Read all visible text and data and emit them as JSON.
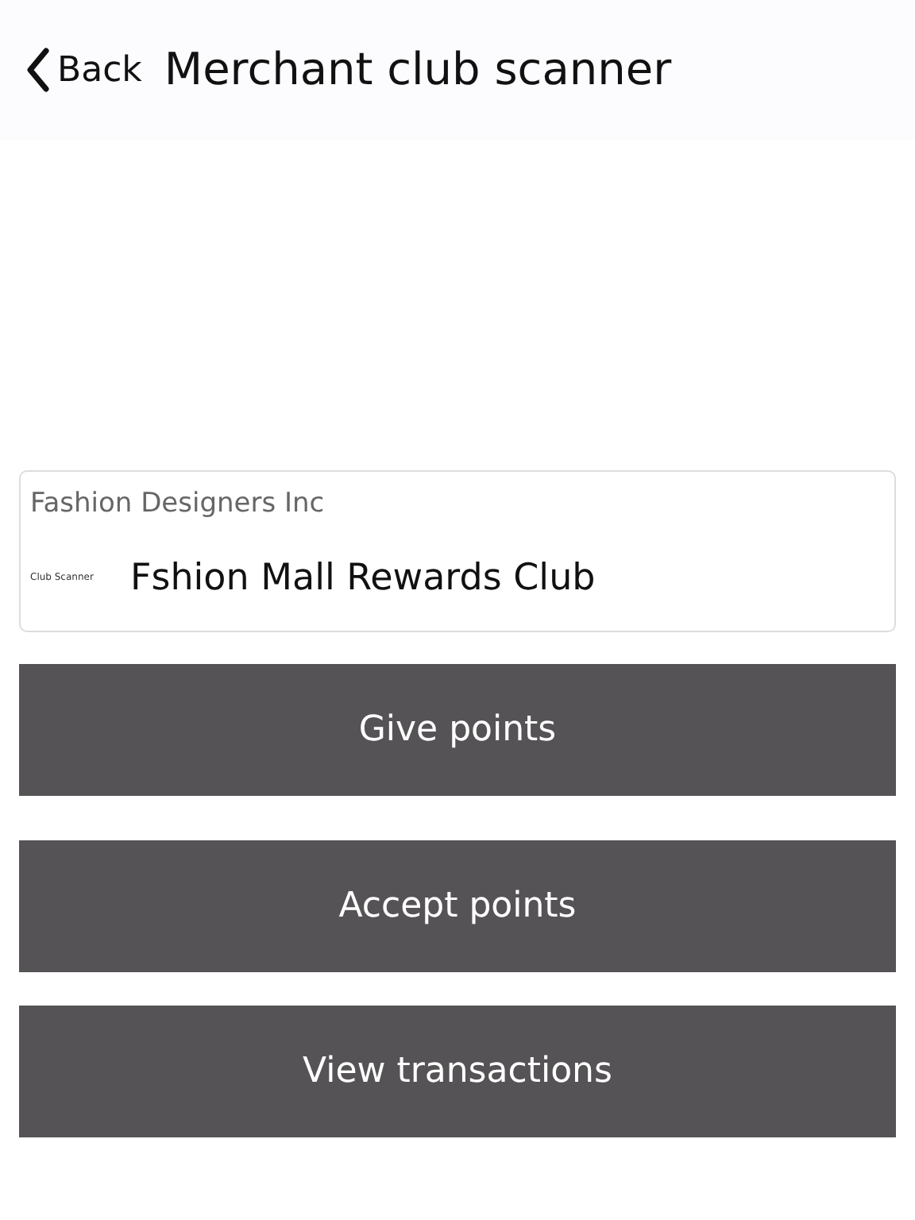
{
  "header": {
    "back_label": "Back",
    "title": "Merchant club scanner"
  },
  "card": {
    "merchant": "Fashion Designers Inc",
    "caption": "Club Scanner",
    "club": "Fshion Mall Rewards Club"
  },
  "buttons": [
    {
      "label": "Give points"
    },
    {
      "label": "Accept points"
    },
    {
      "label": "View transactions"
    }
  ]
}
